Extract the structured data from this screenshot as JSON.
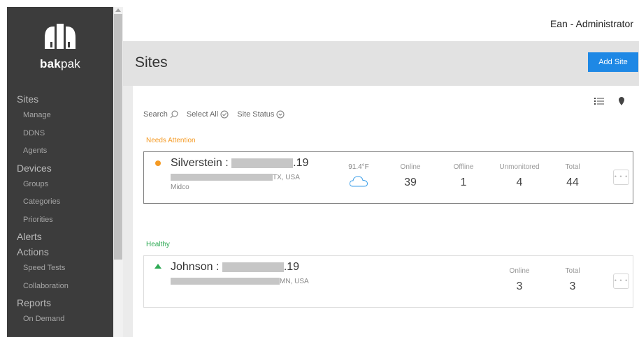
{
  "brand": {
    "name_bold": "bak",
    "name_regular": "pak"
  },
  "user": {
    "display": "Ean - Administrator"
  },
  "nav": {
    "sites": "Sites",
    "manage": "Manage",
    "ddns": "DDNS",
    "agents": "Agents",
    "devices": "Devices",
    "groups": "Groups",
    "categories": "Categories",
    "priorities": "Priorities",
    "alerts": "Alerts",
    "actions": "Actions",
    "speed_tests": "Speed Tests",
    "collaboration": "Collaboration",
    "reports": "Reports",
    "on_demand": "On Demand"
  },
  "header": {
    "title": "Sites",
    "add_button": "Add Site"
  },
  "filters": {
    "search": "Search",
    "select_all": "Select All",
    "site_status": "Site Status"
  },
  "groups": {
    "needs_attention": "Needs Attention",
    "healthy": "Healthy"
  },
  "sites": [
    {
      "name_prefix": "Silverstein : ",
      "name_suffix": ".19",
      "location": "TX, USA",
      "isp": "Midco",
      "temperature": "91.4°F",
      "stats": [
        {
          "label": "Online",
          "value": "39"
        },
        {
          "label": "Offline",
          "value": "1"
        },
        {
          "label": "Unmonitored",
          "value": "4"
        },
        {
          "label": "Total",
          "value": "44"
        }
      ],
      "more": "• • •"
    },
    {
      "name_prefix": "Johnson : ",
      "name_suffix": ".19",
      "location": "MN, USA",
      "stats": [
        {
          "label": "Online",
          "value": "3"
        },
        {
          "label": "Total",
          "value": "3"
        }
      ],
      "more": "• • •"
    }
  ],
  "colors": {
    "sidebar": "#3c3c3c",
    "accent": "#1e88e5",
    "attention": "#f59a23",
    "healthy": "#2eaa54"
  },
  "icons": [
    "logo-icon",
    "search-icon",
    "check-circle-icon",
    "chevron-circle-icon",
    "list-view-icon",
    "map-pin-icon",
    "cloud-icon",
    "status-dot-icon",
    "status-up-arrow-icon",
    "more-icon"
  ]
}
